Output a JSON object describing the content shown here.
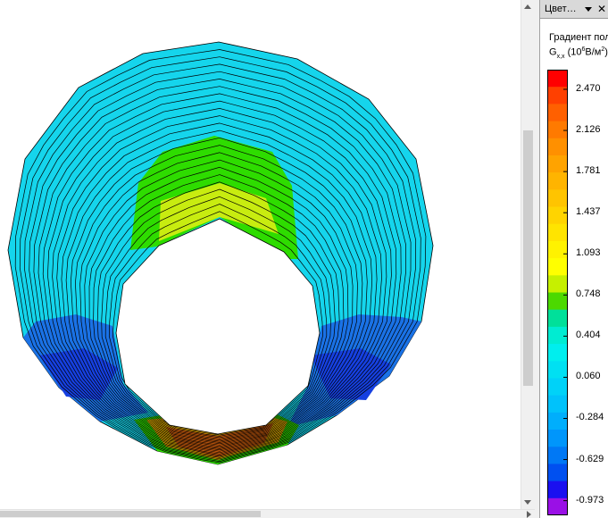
{
  "panel": {
    "title": "Цвет…",
    "close_glyph": "✕",
    "menu_icon": "dropdown-arrow-icon"
  },
  "legend": {
    "title": "Градиент пол",
    "unit_base": "G",
    "unit_sub": "x,x",
    "unit_open": " (10",
    "unit_exp": "6",
    "unit_mid": "В/м",
    "unit_exp2": "2",
    "unit_close": ")",
    "colors": [
      "#ff0000",
      "#ff4000",
      "#ff6000",
      "#ff7a00",
      "#ff9000",
      "#ffa300",
      "#ffb400",
      "#ffc400",
      "#ffd400",
      "#ffe400",
      "#fff200",
      "#ffff00",
      "#c6f000",
      "#4cd900",
      "#00e09a",
      "#00ecd2",
      "#00eeee",
      "#00e0f2",
      "#00d2f8",
      "#00c2fb",
      "#00aefc",
      "#0096fb",
      "#0078f5",
      "#0050f0",
      "#1a10f0",
      "#9a10e6"
    ],
    "tick_labels": [
      "2.470",
      "2.126",
      "1.781",
      "1.437",
      "1.093",
      "0.748",
      "0.404",
      "0.060",
      "-0.284",
      "-0.629",
      "-0.973"
    ]
  },
  "plot": {
    "colors": {
      "outer_band": "#15d5ec",
      "green_band": "#2edc00",
      "yellow_band": "#c8ec10",
      "blue_region": "#1a72e6",
      "deep_blue": "#1640e0",
      "hot_outer": "#e6b000",
      "hot_inner": "#e86a10",
      "contour": "#000000"
    }
  },
  "scrollbars": {
    "vertical_thumb_color": "#cdcdcd",
    "horizontal_thumb_color": "#cdcdcd"
  }
}
